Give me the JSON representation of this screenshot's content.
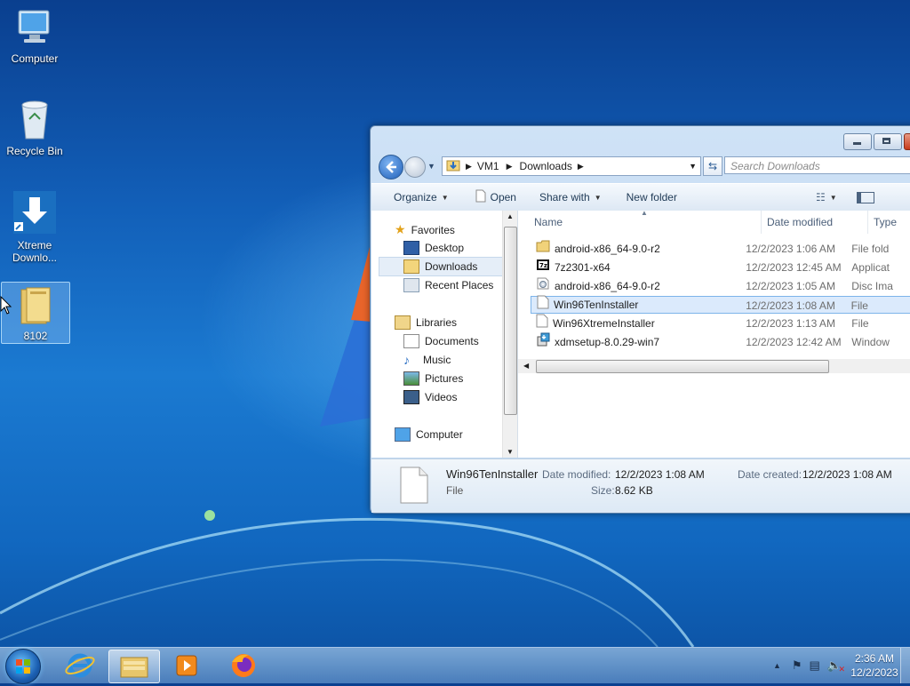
{
  "desktop": {
    "icons": [
      {
        "label": "Computer"
      },
      {
        "label": "Recycle Bin"
      },
      {
        "label": "Xtreme Downlo..."
      },
      {
        "label": "8102"
      }
    ]
  },
  "explorer": {
    "breadcrumb": [
      "VM1",
      "Downloads"
    ],
    "search_placeholder": "Search Downloads",
    "toolbar": {
      "organize": "Organize",
      "open": "Open",
      "share_with": "Share with",
      "new_folder": "New folder"
    },
    "nav": {
      "favorites": "Favorites",
      "desktop": "Desktop",
      "downloads": "Downloads",
      "recent_places": "Recent Places",
      "libraries": "Libraries",
      "documents": "Documents",
      "music": "Music",
      "pictures": "Pictures",
      "videos": "Videos",
      "computer": "Computer"
    },
    "columns": {
      "name": "Name",
      "date_modified": "Date modified",
      "type": "Type"
    },
    "files": [
      {
        "name": "android-x86_64-9.0-r2",
        "date": "12/2/2023 1:06 AM",
        "type": "File fold",
        "icon": "folder-icon"
      },
      {
        "name": "7z2301-x64",
        "date": "12/2/2023 12:45 AM",
        "type": "Applicat",
        "icon": "7zip-icon"
      },
      {
        "name": "android-x86_64-9.0-r2",
        "date": "12/2/2023 1:05 AM",
        "type": "Disc Ima",
        "icon": "disc-image-icon"
      },
      {
        "name": "Win96TenInstaller",
        "date": "12/2/2023 1:08 AM",
        "type": "File",
        "icon": "file-icon",
        "selected": true
      },
      {
        "name": "Win96XtremeInstaller",
        "date": "12/2/2023 1:13 AM",
        "type": "File",
        "icon": "file-icon"
      },
      {
        "name": "xdmsetup-8.0.29-win7",
        "date": "12/2/2023 12:42 AM",
        "type": "Window",
        "icon": "setup-icon"
      }
    ],
    "details": {
      "name": "Win96TenInstaller",
      "type": "File",
      "date_modified_label": "Date modified:",
      "date_modified": "12/2/2023 1:08 AM",
      "date_created_label": "Date created:",
      "date_created": "12/2/2023 1:08 AM",
      "size_label": "Size:",
      "size": "8.62 KB"
    }
  },
  "taskbar": {
    "clock_time": "2:36 AM",
    "clock_date": "12/2/2023"
  }
}
